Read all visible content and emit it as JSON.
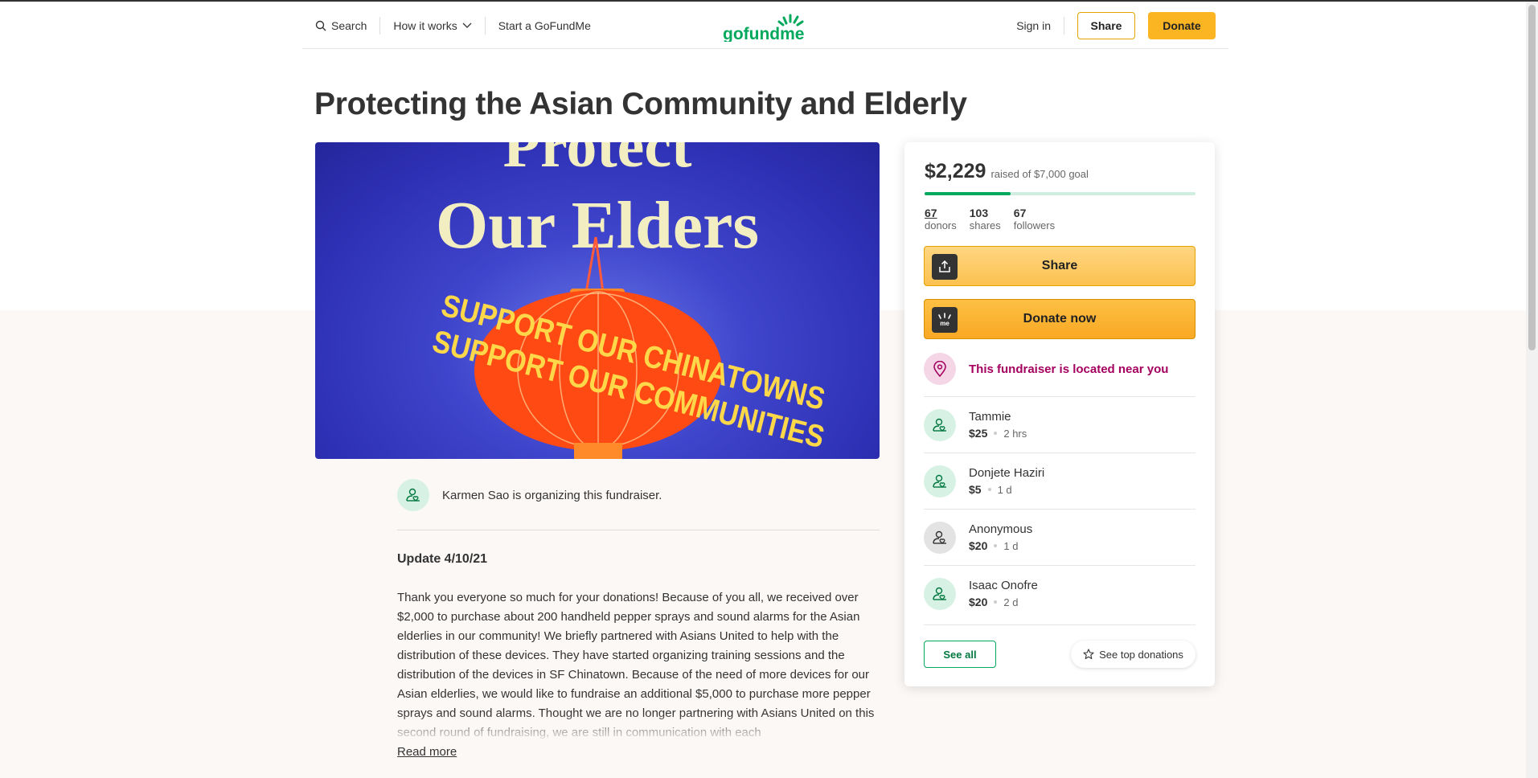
{
  "header": {
    "search_label": "Search",
    "how_label": "How it works",
    "start_label": "Start a GoFundMe",
    "logo_text": "gofundme",
    "signin_label": "Sign in",
    "share_label": "Share",
    "donate_label": "Donate"
  },
  "campaign": {
    "title": "Protecting the Asian Community and Elderly",
    "hero_text": {
      "line1": "Protect",
      "line2": "Our Elders",
      "band1": "SUPPORT OUR CHINATOWNS",
      "band2": "SUPPORT OUR COMMUNITIES"
    },
    "organizer_text": "Karmen Sao is organizing this fundraiser.",
    "update_title": "Update 4/10/21",
    "story": "Thank you everyone so much for your donations! Because of you all, we received over $2,000 to purchase about 200 handheld pepper sprays and sound alarms for the Asian elderlies in our community! We briefly partnered with  Asians United to help with the distribution of these devices. They have started organizing training sessions and the distribution of the devices in SF Chinatown. Because of the need of more devices for our Asian elderlies, we would like to fundraise an additional $5,000 to purchase more pepper sprays and sound alarms. Thought we are no longer partnering with Asians United on this second round of fundraising, we are still in communication with each",
    "read_more": "Read more"
  },
  "donation_card": {
    "raised": "$2,229",
    "goal_text": "raised of $7,000 goal",
    "progress_fraction": 0.318,
    "stats": [
      {
        "num": "67",
        "label": "donors"
      },
      {
        "num": "103",
        "label": "shares"
      },
      {
        "num": "67",
        "label": "followers"
      }
    ],
    "share_label": "Share",
    "donate_label": "Donate now",
    "near_text": "This fundraiser is located near you",
    "donations": [
      {
        "name": "Tammie",
        "amount": "$25",
        "time": "2 hrs"
      },
      {
        "name": "Donjete Haziri",
        "amount": "$5",
        "time": "1 d"
      },
      {
        "name": "Anonymous",
        "amount": "$20",
        "time": "1 d"
      },
      {
        "name": "Isaac Onofre",
        "amount": "$20",
        "time": "2 d"
      }
    ],
    "see_all_label": "See all",
    "see_top_label": "See top donations"
  },
  "colors": {
    "brand_green": "#02a95c",
    "donate_yellow": "#fbb422",
    "near_pink": "#a4005e"
  }
}
